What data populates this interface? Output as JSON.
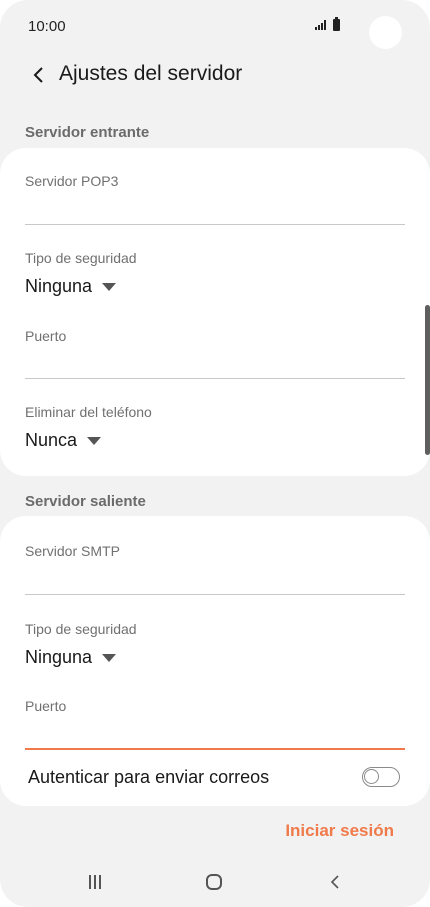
{
  "status_bar": {
    "time": "10:00"
  },
  "header": {
    "title": "Ajustes del servidor"
  },
  "incoming": {
    "section_label": "Servidor entrante",
    "server_label": "Servidor POP3",
    "server_value": "",
    "security_label": "Tipo de seguridad",
    "security_value": "Ninguna",
    "port_label": "Puerto",
    "port_value": "",
    "delete_label": "Eliminar del teléfono",
    "delete_value": "Nunca"
  },
  "outgoing": {
    "section_label": "Servidor saliente",
    "server_label": "Servidor SMTP",
    "server_value": "",
    "security_label": "Tipo de seguridad",
    "security_value": "Ninguna",
    "port_label": "Puerto",
    "port_value": "",
    "auth_label": "Autenticar para enviar correos",
    "auth_enabled": false
  },
  "actions": {
    "signin_label": "Iniciar sesión"
  },
  "colors": {
    "accent": "#f07a4a",
    "background": "#f2f2f2",
    "card": "#ffffff"
  },
  "icons": {
    "back": "chevron-left-icon",
    "signal": "signal-icon",
    "battery": "battery-icon",
    "dropdown": "caret-down-icon",
    "nav_recent": "recent-apps-icon",
    "nav_home": "home-icon",
    "nav_back": "back-icon"
  }
}
